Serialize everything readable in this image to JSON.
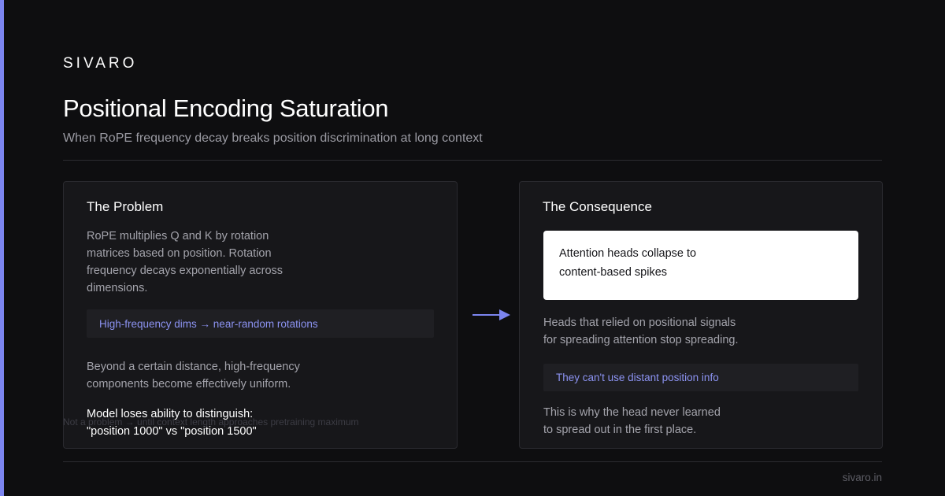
{
  "brand": "SIVARO",
  "header": {
    "title": "Positional Encoding Saturation",
    "subtitle": "When RoPE frequency decay breaks position discrimination at long context"
  },
  "problem": {
    "title": "The Problem",
    "intro": [
      "RoPE multiplies Q and K by rotation",
      "matrices based on position. Rotation",
      "frequency decays exponentially across",
      "dimensions."
    ],
    "highlight": "High-frequency dims → near-random rotations",
    "detail": [
      "Beyond a certain distance, high-frequency",
      "components become effectively uniform."
    ],
    "conclusion": [
      "Model loses ability to distinguish:",
      "\"position 1000\" vs \"position 1500\""
    ]
  },
  "consequence": {
    "title": "The Consequence",
    "callout": [
      "Attention heads collapse to",
      "content-based spikes"
    ],
    "body": [
      "Heads that relied on positional signals",
      "for spreading attention stop spreading."
    ],
    "highlight": "They can't use distant position info",
    "closing": [
      "This is why the head never learned",
      "to spread out in the first place."
    ]
  },
  "footnote": "Not a problem → until context length approaches pretraining maximum",
  "footer": {
    "site": "sivaro.in"
  },
  "colors": {
    "accent": "#7c85f0",
    "background": "#0e0e10",
    "card": "#17171a",
    "highlight_text": "#8c93f2"
  },
  "icons": {
    "arrow": "right-arrow-icon"
  }
}
